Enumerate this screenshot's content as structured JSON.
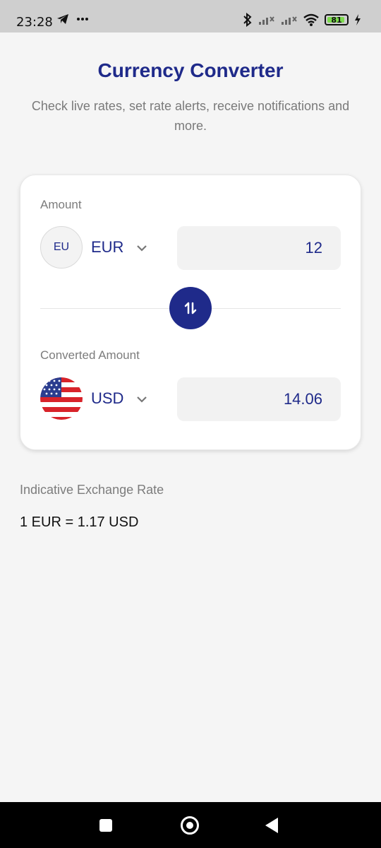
{
  "status_bar": {
    "time": "23:28",
    "battery": "81",
    "icons": [
      "telegram-icon",
      "more-icon",
      "bluetooth-icon",
      "signal-icon",
      "signal-icon",
      "wifi-icon",
      "battery-icon",
      "charging-icon"
    ]
  },
  "header": {
    "title": "Currency Converter",
    "subtitle": "Check live rates, set rate alerts, receive notifications and more."
  },
  "converter": {
    "amount_label": "Amount",
    "from_flag_text": "EU",
    "from_currency": "EUR",
    "amount_value": "12",
    "converted_label": "Converted Amount",
    "to_currency": "USD",
    "converted_value": "14.06"
  },
  "rate": {
    "label": "Indicative Exchange Rate",
    "value": "1 EUR = 1.17 USD"
  },
  "colors": {
    "accent": "#1f2a8a",
    "background": "#f5f5f5",
    "card": "#ffffff"
  },
  "nav_bar": {
    "icons": [
      "recents-icon",
      "home-icon",
      "back-icon"
    ]
  }
}
